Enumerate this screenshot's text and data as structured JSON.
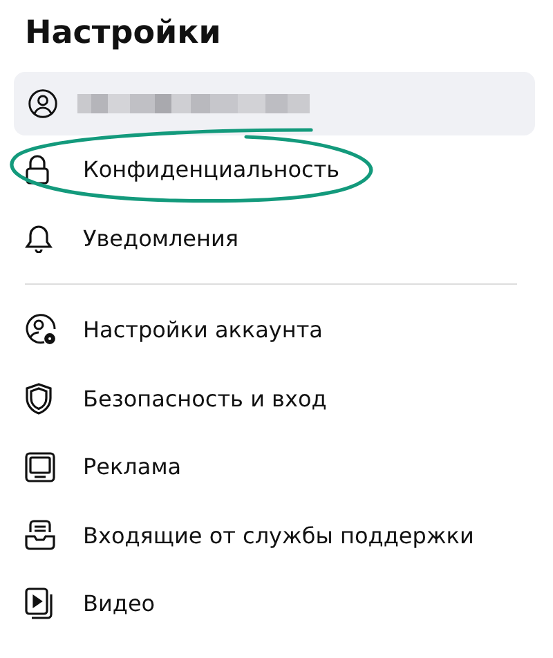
{
  "title": "Настройки",
  "profile": {
    "selected": true
  },
  "sections": [
    {
      "items": [
        {
          "label": "Конфиденциальность",
          "circled": true
        },
        {
          "label": "Уведомления",
          "circled": false
        }
      ]
    },
    {
      "items": [
        {
          "label": "Настройки аккаунта",
          "circled": false
        },
        {
          "label": "Безопасность и вход",
          "circled": false
        },
        {
          "label": "Реклама",
          "circled": false
        },
        {
          "label": "Входящие от службы поддержки",
          "circled": false
        },
        {
          "label": "Видео",
          "circled": false
        }
      ]
    }
  ]
}
